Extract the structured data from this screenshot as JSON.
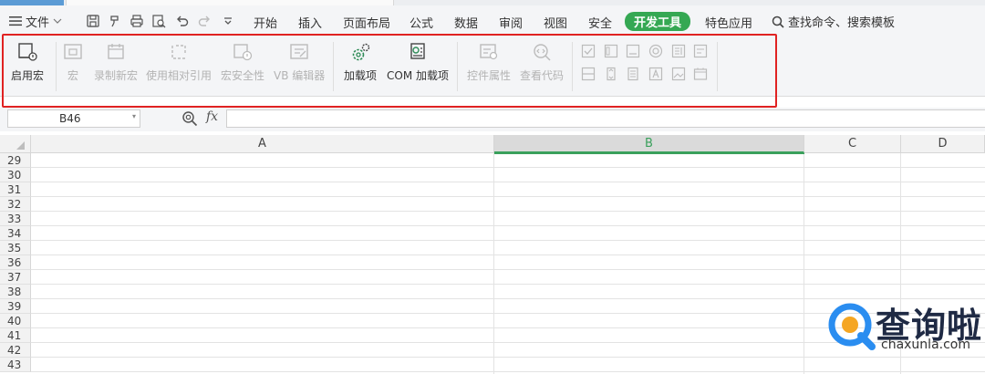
{
  "menubar": {
    "file_label": "文件",
    "tabs": [
      "开始",
      "插入",
      "页面布局",
      "公式",
      "数据",
      "审阅",
      "视图",
      "安全",
      "开发工具",
      "特色应用"
    ],
    "active_tab": "开发工具",
    "search_label": "查找命令、搜索模板"
  },
  "ribbon": {
    "enable_macro": "启用宏",
    "macro": "宏",
    "record_macro": "录制新宏",
    "relative_ref": "使用相对引用",
    "macro_security": "宏安全性",
    "vb_editor": "VB 编辑器",
    "addins": "加载项",
    "com_addins": "COM 加载项",
    "control_props": "控件属性",
    "view_code": "查看代码"
  },
  "formula": {
    "name_box": "B46",
    "fx": "fx"
  },
  "grid": {
    "columns": [
      "A",
      "B",
      "C",
      "D"
    ],
    "selected_column": "B",
    "rows": [
      "29",
      "30",
      "31",
      "32",
      "33",
      "34",
      "35",
      "36",
      "37",
      "38",
      "39",
      "40",
      "41",
      "42",
      "43"
    ]
  },
  "watermark": {
    "title": "查询啦",
    "url": "chaxunla.com"
  },
  "colors": {
    "accent_green": "#35a853",
    "highlight_red": "#e02222"
  }
}
